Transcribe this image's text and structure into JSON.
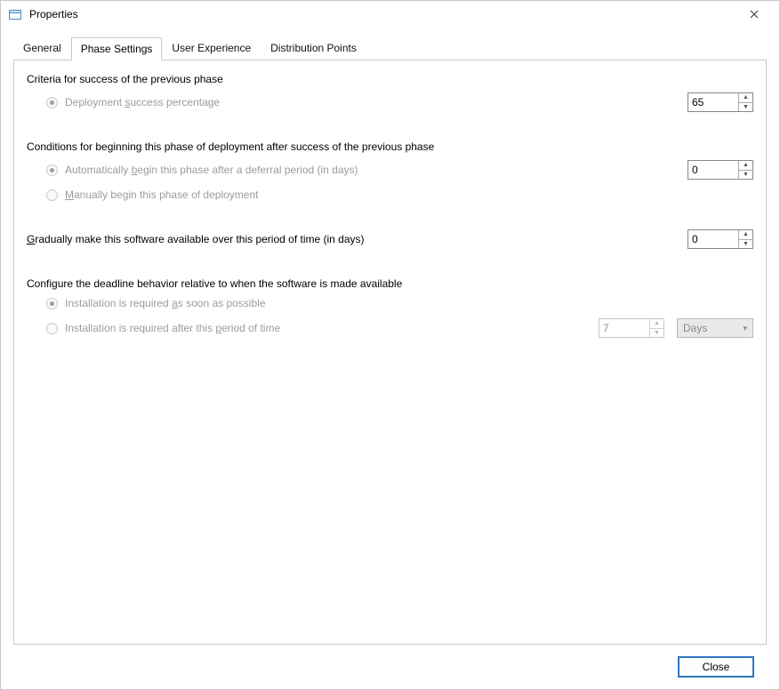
{
  "window": {
    "title": "Properties"
  },
  "tabs": [
    {
      "label": "General"
    },
    {
      "label": "Phase Settings"
    },
    {
      "label": "User Experience"
    },
    {
      "label": "Distribution Points"
    }
  ],
  "criteria": {
    "heading": "Criteria for success of the previous phase",
    "success_percentage": {
      "label_pre": "Deployment ",
      "label_u": "s",
      "label_post": "uccess percentage",
      "value": "65"
    }
  },
  "conditions": {
    "heading": "Conditions for beginning this phase of deployment after success of the previous phase",
    "auto": {
      "label_pre": "Automatically ",
      "label_u": "b",
      "label_post": "egin this phase after a deferral period (in days)",
      "value": "0"
    },
    "manual": {
      "label_u": "M",
      "label_post": "anually begin this phase of deployment"
    }
  },
  "gradual": {
    "label_u": "G",
    "label_post": "radually make this software available over this period of time (in days)",
    "value": "0"
  },
  "deadline": {
    "heading": "Configure the deadline behavior relative to when the software is made available",
    "asap": {
      "label_pre": "Installation is required ",
      "label_u": "a",
      "label_post": "s soon as possible"
    },
    "after": {
      "label_pre": "Installation is required after this ",
      "label_u": "p",
      "label_post": "eriod of time",
      "value": "7",
      "unit": "Days"
    }
  },
  "buttons": {
    "close": "Close"
  }
}
